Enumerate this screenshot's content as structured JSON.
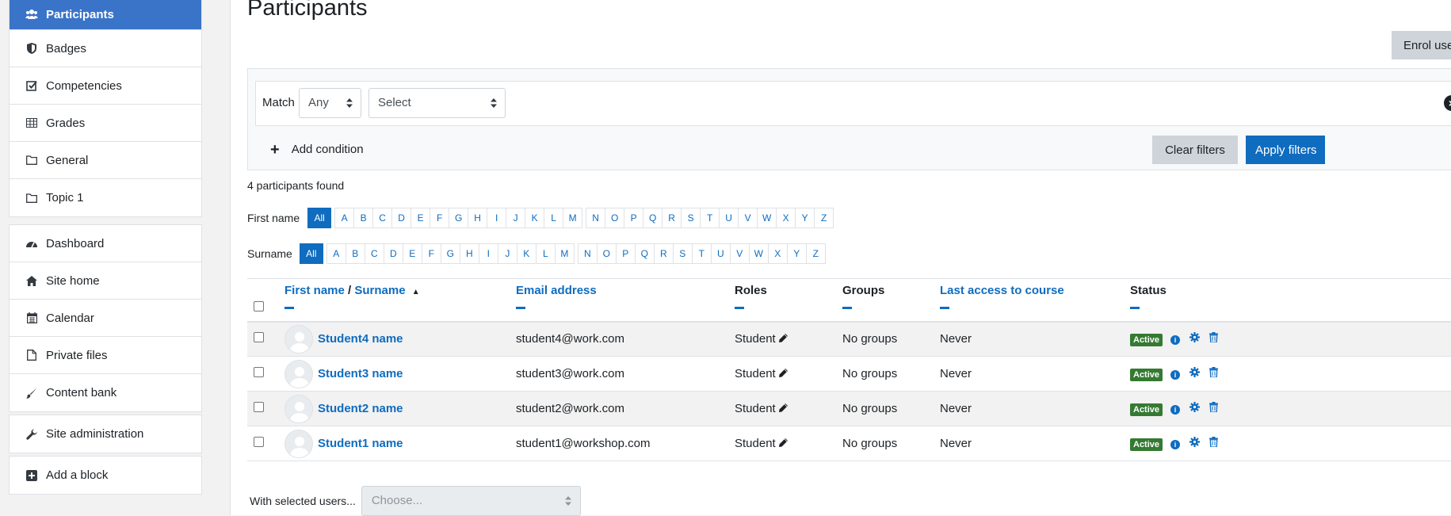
{
  "sidebar": {
    "group1": [
      {
        "label": "Participants",
        "icon": "users-icon",
        "active": true
      },
      {
        "label": "Badges",
        "icon": "shield-icon"
      },
      {
        "label": "Competencies",
        "icon": "checkbox-icon"
      },
      {
        "label": "Grades",
        "icon": "table-icon"
      },
      {
        "label": "General",
        "icon": "folder-icon"
      },
      {
        "label": "Topic 1",
        "icon": "folder-icon"
      }
    ],
    "group2": [
      {
        "label": "Dashboard",
        "icon": "dashboard-icon"
      },
      {
        "label": "Site home",
        "icon": "home-icon"
      },
      {
        "label": "Calendar",
        "icon": "calendar-icon"
      },
      {
        "label": "Private files",
        "icon": "file-icon"
      },
      {
        "label": "Content bank",
        "icon": "brush-icon"
      }
    ],
    "group3": [
      {
        "label": "Site administration",
        "icon": "wrench-icon"
      }
    ],
    "group4": [
      {
        "label": "Add a block",
        "icon": "plus-square-icon"
      }
    ]
  },
  "page": {
    "title": "Participants",
    "enrol_button": "Enrol users"
  },
  "filter": {
    "match_label": "Match",
    "match_value": "Any",
    "field_value": "Select",
    "add_condition": "Add condition",
    "clear_button": "Clear filters",
    "apply_button": "Apply filters"
  },
  "results": {
    "count_text": "4 participants found"
  },
  "initials": {
    "firstname_label": "First name",
    "surname_label": "Surname",
    "all": "All",
    "letters": [
      "A",
      "B",
      "C",
      "D",
      "E",
      "F",
      "G",
      "H",
      "I",
      "J",
      "K",
      "L",
      "M",
      "N",
      "O",
      "P",
      "Q",
      "R",
      "S",
      "T",
      "U",
      "V",
      "W",
      "X",
      "Y",
      "Z"
    ]
  },
  "table": {
    "headers": {
      "firstname": "First name",
      "separator": " / ",
      "surname": "Surname",
      "email": "Email address",
      "roles": "Roles",
      "groups": "Groups",
      "lastaccess": "Last access to course",
      "status": "Status"
    },
    "rows": [
      {
        "name": "Student4 name",
        "email": "student4@work.com",
        "role": "Student",
        "groups": "No groups",
        "lastaccess": "Never",
        "status": "Active"
      },
      {
        "name": "Student3 name",
        "email": "student3@work.com",
        "role": "Student",
        "groups": "No groups",
        "lastaccess": "Never",
        "status": "Active"
      },
      {
        "name": "Student2 name",
        "email": "student2@work.com",
        "role": "Student",
        "groups": "No groups",
        "lastaccess": "Never",
        "status": "Active"
      },
      {
        "name": "Student1 name",
        "email": "student1@workshop.com",
        "role": "Student",
        "groups": "No groups",
        "lastaccess": "Never",
        "status": "Active"
      }
    ]
  },
  "bulk": {
    "label": "With selected users...",
    "placeholder": "Choose..."
  },
  "colors": {
    "primary": "#0f6cbf",
    "sidebar_active": "#3a74c8",
    "status_active": "#357a32"
  }
}
